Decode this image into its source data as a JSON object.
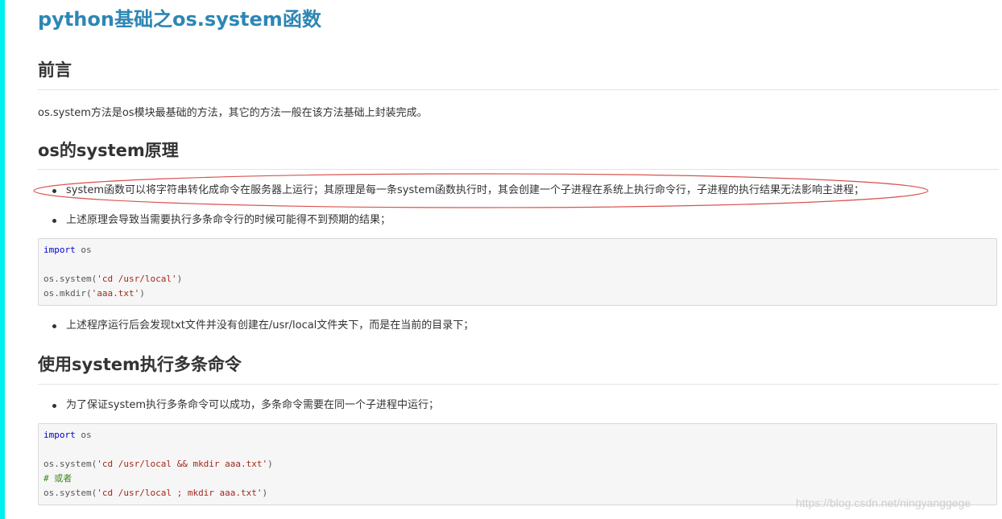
{
  "title": "python基础之os.system函数",
  "sections": [
    {
      "heading": "前言",
      "paragraph": "os.system方法是os模块最基础的方法，其它的方法一般在该方法基础上封装完成。"
    },
    {
      "heading": "os的system原理",
      "bullets": [
        "system函数可以将字符串转化成命令在服务器上运行；其原理是每一条system函数执行时，其会创建一个子进程在系统上执行命令行，子进程的执行结果无法影响主进程；",
        "上述原理会导致当需要执行多条命令行的时候可能得不到预期的结果；"
      ],
      "code": {
        "line1_kw": "import",
        "line1_rest": " os",
        "line3_pre": "os.system(",
        "line3_str": "'cd /usr/local'",
        "line3_post": ")",
        "line4_pre": "os.mkdir(",
        "line4_str": "'aaa.txt'",
        "line4_post": ")"
      },
      "bullet_after": "上述程序运行后会发现txt文件并没有创建在/usr/local文件夹下，而是在当前的目录下；"
    },
    {
      "heading": "使用system执行多条命令",
      "bullets": [
        "为了保证system执行多条命令可以成功，多条命令需要在同一个子进程中运行；"
      ],
      "code": {
        "line1_kw": "import",
        "line1_rest": " os",
        "line3_pre": "os.system(",
        "line3_str": "'cd /usr/local && mkdir aaa.txt'",
        "line3_post": ")",
        "line4_cmt": "# 或者",
        "line5_pre": "os.system(",
        "line5_str": "'cd /usr/local ; mkdir aaa.txt'",
        "line5_post": ")"
      }
    }
  ],
  "watermark": "https://blog.csdn.net/ningyanggege",
  "colors": {
    "title": "#2d87b4",
    "left_bar": "#00f0f0",
    "annotation_ellipse": "#d9534f"
  }
}
